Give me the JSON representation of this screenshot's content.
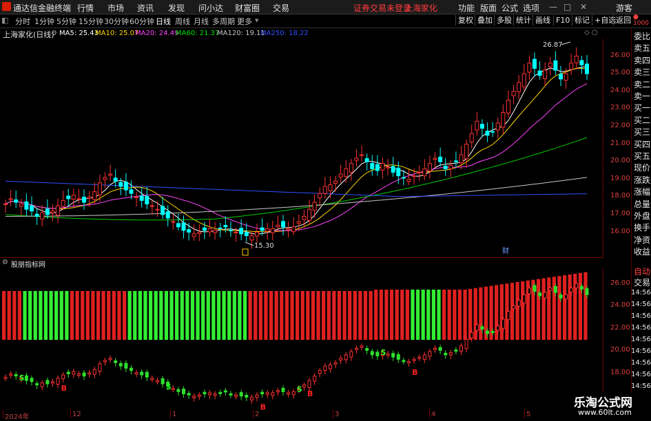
{
  "titlebar": {
    "app_title": "通达信金融终端",
    "menus": [
      "行情",
      "市场",
      "资讯",
      "发现",
      "问小达",
      "财富圈",
      "交易"
    ],
    "notice": "证券交易未登录",
    "stock": "上海家化",
    "right_menus": [
      "功能",
      "版面",
      "公式",
      "选项"
    ],
    "user": "游客"
  },
  "toolbar": {
    "periods": [
      "分时",
      "1分钟",
      "5分钟",
      "15分钟",
      "30分钟",
      "60分钟",
      "日线",
      "周线",
      "月线",
      "多周期",
      "更多"
    ],
    "active_period": "日线",
    "right_buttons": [
      "复权",
      "叠加",
      "多股",
      "统计",
      "画线",
      "F10",
      "标记",
      "+自选",
      "返回"
    ]
  },
  "main_chart": {
    "title": "上海家化(日线)",
    "ma_labels": [
      {
        "text": "MA5: 25.43",
        "color": "#ffffff"
      },
      {
        "text": "MA10: 25.07",
        "color": "#ffd700"
      },
      {
        "text": "MA20: 24.49",
        "color": "#ff44ff"
      },
      {
        "text": "MA60: 21.37",
        "color": "#00e000"
      },
      {
        "text": "MA120: 19.11",
        "color": "#c8c8c8"
      },
      {
        "text": "MA250: 18.22",
        "color": "#3050ff"
      }
    ],
    "price_ticks": [
      "26.00",
      "25.00",
      "24.00",
      "23.00",
      "22.00",
      "21.00",
      "20.00",
      "19.00",
      "18.00",
      "17.00",
      "16.00"
    ],
    "high_label": "26.87",
    "low_label": "15.30",
    "marker_cai": "财",
    "colors": {
      "up": "#ff3232",
      "down": "#00ffff",
      "grid": "#7a0000"
    }
  },
  "indicator_panel": {
    "title": "股朋指标网",
    "price_ticks": [
      "26.00",
      "24.00",
      "22.00",
      "20.00",
      "18.00"
    ],
    "signal_buy": "B",
    "signal_sell": "S",
    "colors": {
      "red_bar": "#e02020",
      "green_bar": "#33ee33"
    }
  },
  "side_panel": {
    "items": [
      "委比",
      "卖五",
      "卖四",
      "卖三",
      "卖二",
      "卖一",
      "买一",
      "买二",
      "买三",
      "买四",
      "买五",
      "现价",
      "涨跌",
      "涨幅",
      "总量",
      "外盘",
      "换手",
      "净资",
      "收益"
    ],
    "lower_items": [
      "自动",
      "交易"
    ],
    "time_stamp": "14:56",
    "header_mark": "1000"
  },
  "x_axis": {
    "labels": [
      "2024年",
      "12",
      "1",
      "2",
      "3",
      "4",
      "5"
    ]
  },
  "watermark": {
    "line1": "乐淘公式网",
    "line2": "www.60lt.com"
  },
  "chart_data": {
    "type": "candlestick",
    "title": "上海家化(日线)",
    "x_axis_labels": [
      "2024年",
      "12",
      "1",
      "2",
      "3",
      "4",
      "5"
    ],
    "ylim": [
      15.0,
      27.0
    ],
    "close": [
      17.6,
      17.9,
      17.7,
      17.6,
      17.3,
      17.2,
      16.9,
      17.1,
      17.0,
      17.2,
      17.5,
      17.8,
      17.9,
      18.1,
      17.9,
      17.7,
      18.0,
      18.3,
      18.8,
      19.1,
      19.3,
      18.9,
      18.6,
      18.4,
      18.2,
      18.0,
      17.8,
      17.6,
      17.5,
      17.3,
      17.0,
      16.8,
      16.6,
      16.3,
      16.1,
      16.0,
      15.9,
      16.0,
      16.1,
      16.2,
      16.1,
      16.2,
      16.3,
      16.1,
      16.0,
      15.9,
      15.8,
      15.8,
      16.0,
      16.1,
      16.2,
      16.2,
      16.4,
      16.3,
      16.2,
      16.3,
      16.6,
      16.9,
      17.3,
      17.7,
      18.2,
      18.6,
      18.7,
      18.9,
      19.3,
      19.6,
      19.9,
      20.2,
      20.4,
      20.0,
      19.6,
      19.5,
      19.9,
      19.7,
      19.4,
      19.2,
      19.1,
      19.0,
      19.2,
      19.4,
      19.6,
      19.9,
      20.2,
      20.0,
      19.6,
      19.8,
      20.0,
      20.4,
      21.0,
      21.6,
      22.3,
      21.9,
      21.5,
      21.7,
      22.2,
      22.8,
      23.5,
      24.0,
      24.5,
      25.0,
      25.6,
      25.3,
      24.9,
      25.2,
      25.6,
      25.2,
      24.7,
      25.0,
      25.6,
      26.0,
      25.5,
      25.0
    ],
    "ma_values": {
      "MA5": 25.43,
      "MA10": 25.07,
      "MA20": 24.49,
      "MA60": 21.37,
      "MA120": 19.11,
      "MA250": 18.22
    },
    "high": 26.87,
    "low": 15.3,
    "indicator_signals": {
      "B": [
        11,
        49,
        58,
        78
      ],
      "S": [
        3,
        31,
        56,
        72
      ]
    }
  }
}
